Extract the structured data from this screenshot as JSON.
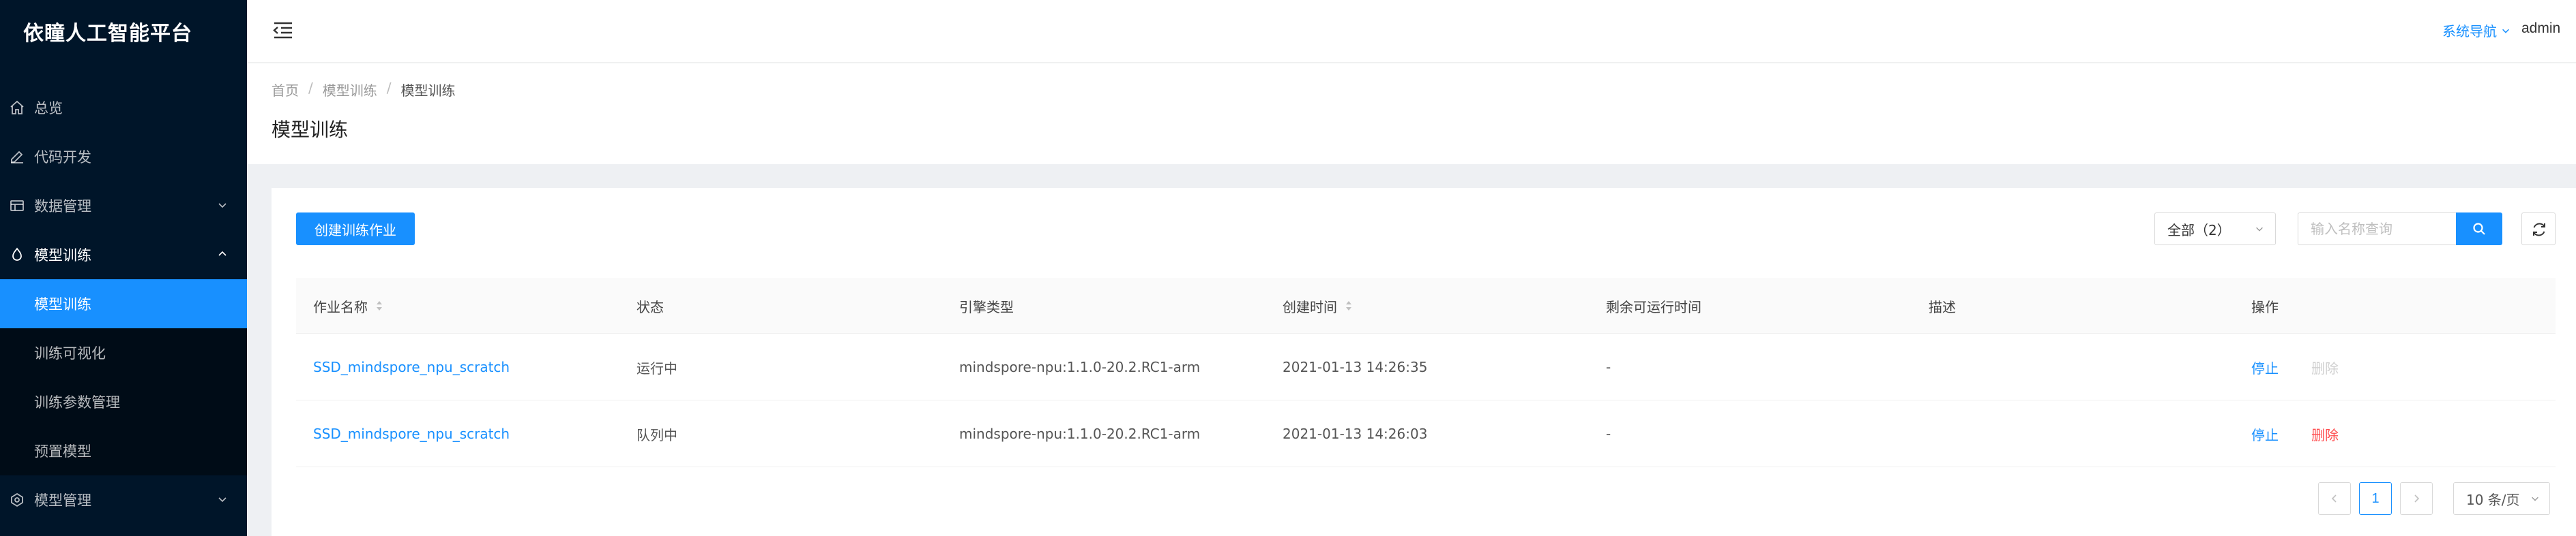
{
  "brand": "依瞳人工智能平台",
  "sidebar": {
    "items": [
      {
        "label": "总览",
        "icon": "home-icon"
      },
      {
        "label": "代码开发",
        "icon": "edit-icon"
      },
      {
        "label": "数据管理",
        "icon": "database-icon"
      },
      {
        "label": "模型训练",
        "icon": "experiment-icon"
      },
      {
        "label": "模型管理",
        "icon": "deployment-icon"
      }
    ],
    "submenu": [
      {
        "label": "模型训练"
      },
      {
        "label": "训练可视化"
      },
      {
        "label": "训练参数管理"
      },
      {
        "label": "预置模型"
      }
    ]
  },
  "header": {
    "sys_nav": "系统导航",
    "user": "admin"
  },
  "breadcrumb": [
    "首页",
    "模型训练",
    "模型训练"
  ],
  "page_title": "模型训练",
  "toolbar": {
    "create_label": "创建训练作业",
    "filter_value": "全部（2）",
    "search_placeholder": "输入名称查询"
  },
  "table": {
    "columns": [
      "作业名称",
      "状态",
      "引擎类型",
      "创建时间",
      "剩余可运行时间",
      "描述",
      "操作"
    ],
    "rows": [
      {
        "name": "SSD_mindspore_npu_scratch",
        "status": "运行中",
        "engine": "mindspore-npu:1.1.0-20.2.RC1-arm",
        "created": "2021-01-13 14:26:35",
        "remaining": "-",
        "desc": "",
        "action_stop": "停止",
        "action_delete": "删除",
        "delete_enabled": false
      },
      {
        "name": "SSD_mindspore_npu_scratch",
        "status": "队列中",
        "engine": "mindspore-npu:1.1.0-20.2.RC1-arm",
        "created": "2021-01-13 14:26:03",
        "remaining": "-",
        "desc": "",
        "action_stop": "停止",
        "action_delete": "删除",
        "delete_enabled": true
      }
    ]
  },
  "pagination": {
    "current_page": "1",
    "page_size": "10 条/页"
  },
  "colors": {
    "primary": "#1890ff",
    "sidebar_bg": "#001529",
    "danger": "#ff4d4f"
  }
}
